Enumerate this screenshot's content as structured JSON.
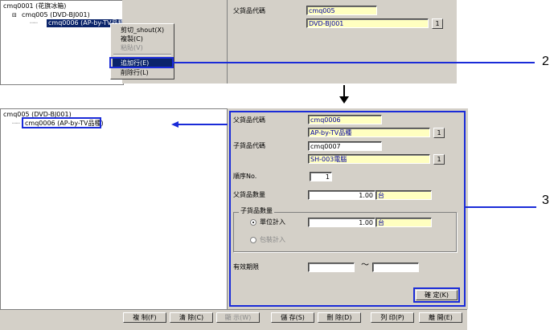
{
  "top": {
    "tree": {
      "root": "cmq0001 (花旗冰箱)",
      "child": "cmq005 (DVD-BJ001)",
      "selected": "cmq0006 (AP-by-TV品種)"
    },
    "context_menu": [
      {
        "label": "剪切_shout(X)",
        "enabled": true
      },
      {
        "label": "複製(C)",
        "enabled": true
      },
      {
        "label": "粘貼(V)",
        "enabled": false
      },
      {
        "label": "追加行(E)",
        "enabled": true,
        "highlighted": true
      },
      {
        "label": "削除行(L)",
        "enabled": true
      }
    ],
    "form": {
      "parent_label": "父貨品代碼",
      "parent_code": "cmq005",
      "parent_name": "DVD-BJ001",
      "lookup_btn": "1"
    }
  },
  "bottom": {
    "tree": {
      "root": "cmq005 (DVD-BJ001)",
      "child": "cmq0006 (AP-by-TV品種)"
    },
    "form": {
      "parent_label": "父貨品代碼",
      "parent_code": "cmq0006",
      "parent_name": "AP-by-TV品種",
      "child_label": "子貨品代碼",
      "child_code": "cmq0007",
      "child_name": "SH-003電腦",
      "lookup_btn": "1",
      "seq_label": "順序No.",
      "seq_value": "1",
      "parent_qty_label": "父貨品數量",
      "parent_qty": "1.00",
      "unit": "台",
      "group_label": "子貨品數量",
      "radio_unit": "單位計入",
      "child_qty": "1.00",
      "child_unit": "台",
      "radio_pack": "包裝計入",
      "valid_label": "有效期限",
      "tilde": "～",
      "valid_from": "",
      "valid_to": "",
      "confirm": "確 定(K)"
    },
    "buttons": [
      {
        "label": "複 制(F)",
        "enabled": true
      },
      {
        "label": "清 除(C)",
        "enabled": true
      },
      {
        "label": "顯 示(W)",
        "enabled": false
      },
      {
        "label": "儲 存(S)",
        "enabled": true
      },
      {
        "label": "刪 除(D)",
        "enabled": true
      },
      {
        "label": "列 印(P)",
        "enabled": true
      },
      {
        "label": "離 開(E)",
        "enabled": true
      }
    ]
  },
  "callouts": {
    "two": "2",
    "three": "3"
  },
  "colors": {
    "accent_blue": "#1a2bd8",
    "selection": "#0a246a",
    "field_yellow": "#ffffc0",
    "panel": "#d4d0c8"
  }
}
